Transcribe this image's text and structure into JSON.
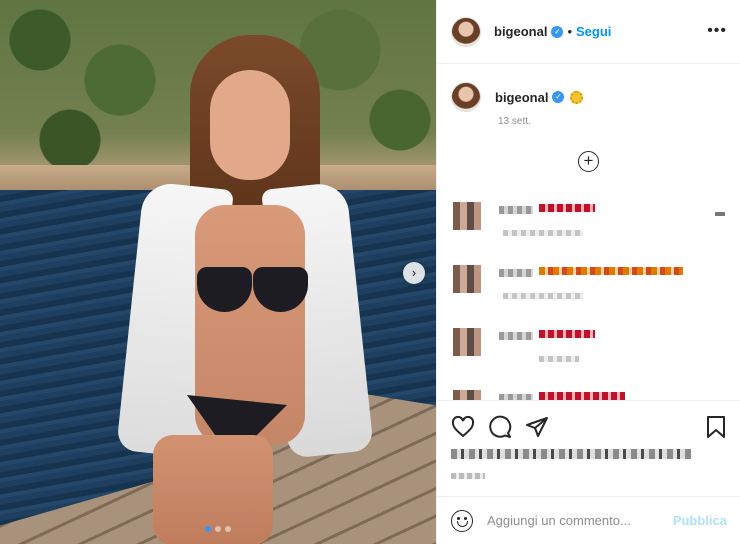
{
  "post": {
    "username": "bigeonal",
    "follow_label": "Segui",
    "separator": "•",
    "more_label": "•••",
    "verified_icon": "verified-badge-icon",
    "caption_emoji": "sun-emoji",
    "date_label": "13 sett.",
    "load_more_symbol": "+",
    "next_arrow": "›"
  },
  "compose": {
    "placeholder": "Aggiungi un commento...",
    "publish_label": "Pubblica"
  },
  "colors": {
    "accent": "#0095f6",
    "publish_disabled": "#b2dffc",
    "carousel_active_dot": "#3897f0"
  },
  "carousel": {
    "slides": 3,
    "active": 1
  }
}
